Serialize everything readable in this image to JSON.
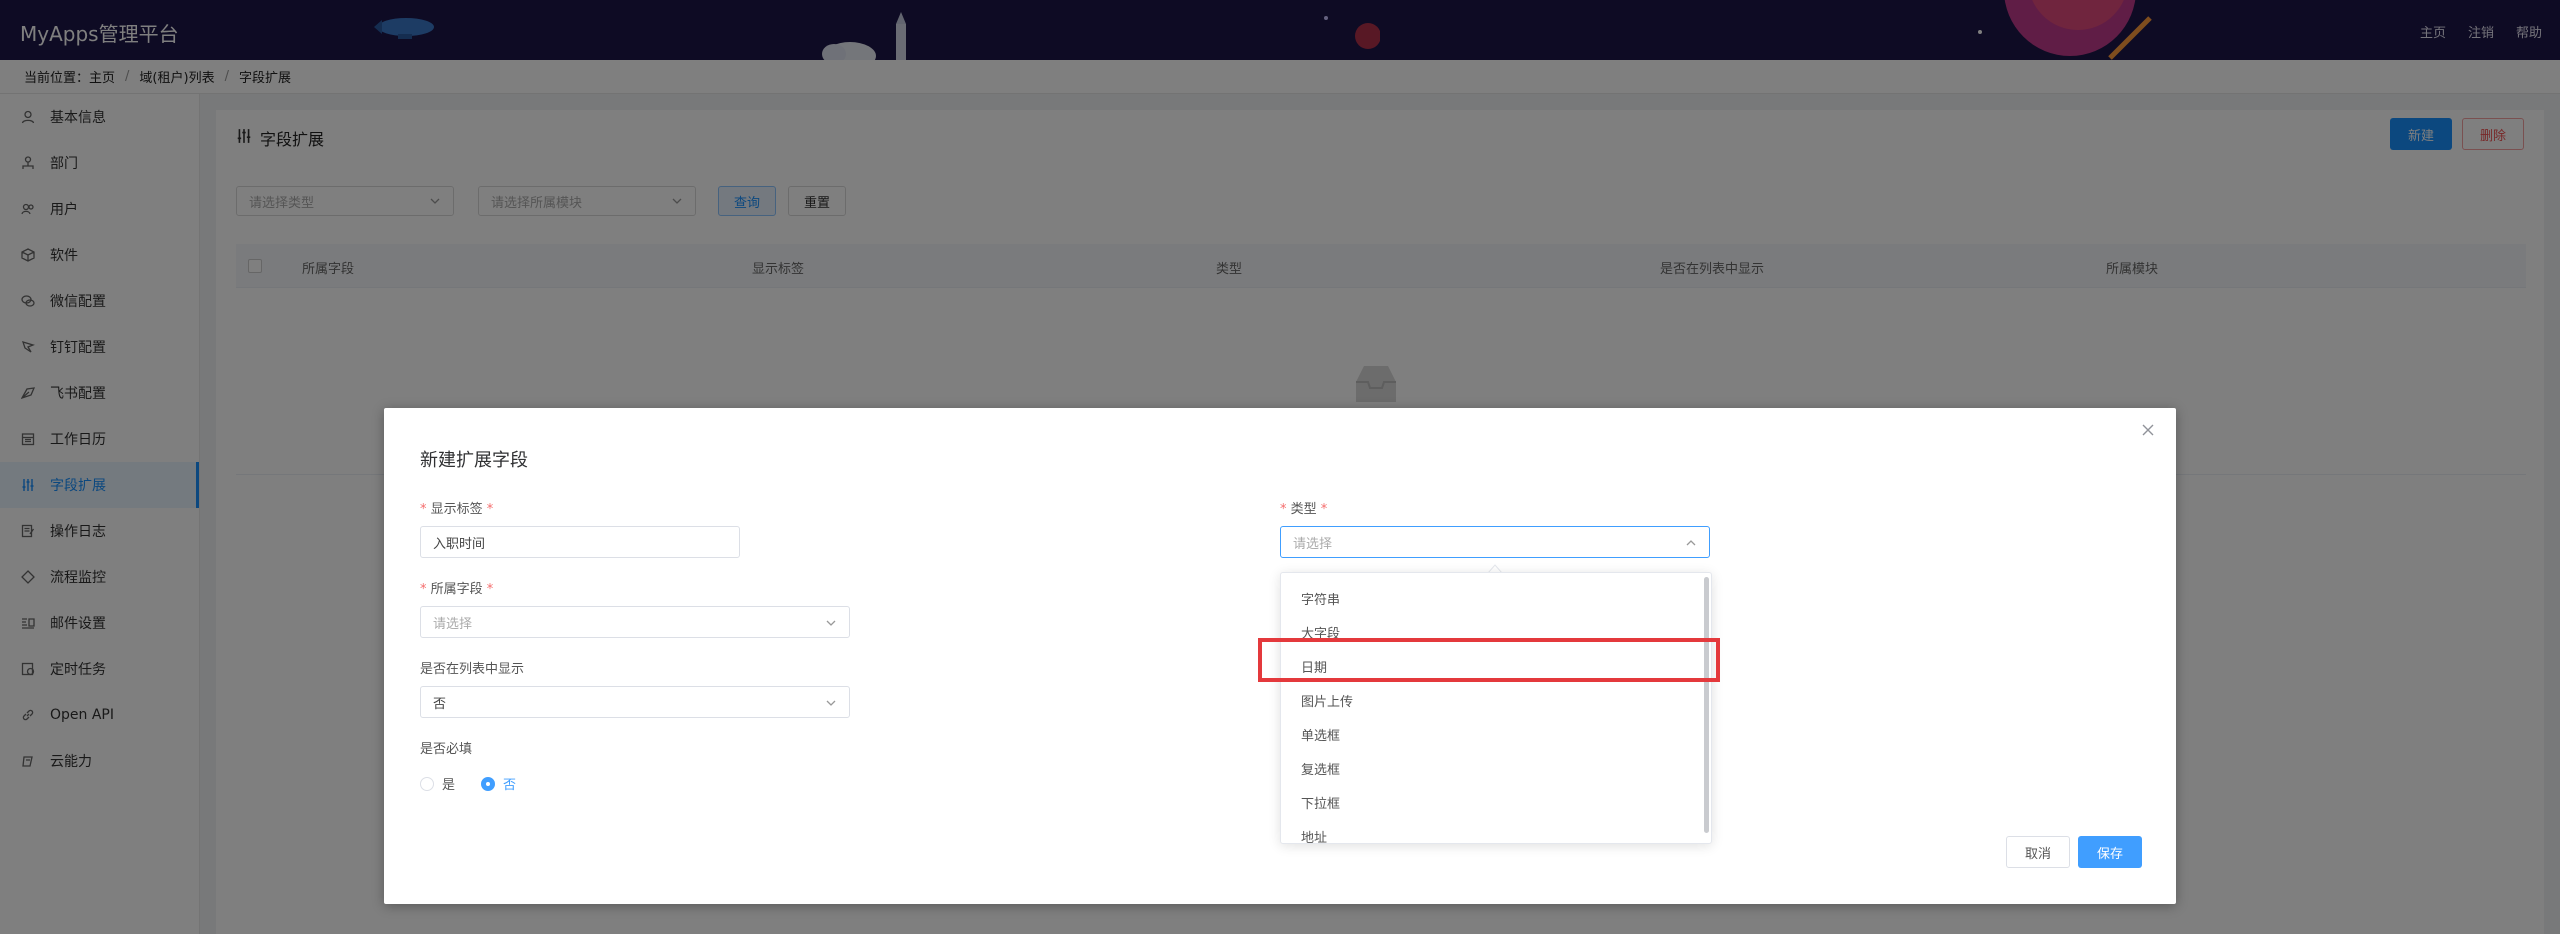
{
  "header": {
    "app_title": "MyApps管理平台",
    "nav": [
      "主页",
      "注销",
      "帮助"
    ]
  },
  "breadcrumb": {
    "prefix": "当前位置：",
    "items": [
      "主页",
      "域(租户)列表",
      "字段扩展"
    ]
  },
  "sidebar": {
    "items": [
      {
        "label": "基本信息",
        "icon": "user-icon"
      },
      {
        "label": "部门",
        "icon": "org-icon"
      },
      {
        "label": "用户",
        "icon": "users-icon"
      },
      {
        "label": "软件",
        "icon": "box-icon"
      },
      {
        "label": "微信配置",
        "icon": "wechat-icon"
      },
      {
        "label": "钉钉配置",
        "icon": "dingtalk-icon"
      },
      {
        "label": "飞书配置",
        "icon": "feishu-icon"
      },
      {
        "label": "工作日历",
        "icon": "calendar-icon"
      },
      {
        "label": "字段扩展",
        "icon": "sliders-icon",
        "active": true
      },
      {
        "label": "操作日志",
        "icon": "log-icon"
      },
      {
        "label": "流程监控",
        "icon": "monitor-icon"
      },
      {
        "label": "邮件设置",
        "icon": "mail-icon"
      },
      {
        "label": "定时任务",
        "icon": "timer-icon"
      },
      {
        "label": "Open API",
        "icon": "link-icon"
      },
      {
        "label": "云能力",
        "icon": "cloud-icon"
      }
    ]
  },
  "main": {
    "title": "字段扩展",
    "new_label": "新建",
    "delete_label": "删除",
    "filter_type_placeholder": "请选择类型",
    "filter_module_placeholder": "请选择所属模块",
    "query_label": "查询",
    "reset_label": "重置",
    "columns": [
      "所属字段",
      "显示标签",
      "类型",
      "是否在列表中显示",
      "所属模块"
    ]
  },
  "dialog": {
    "title": "新建扩展字段",
    "display_label": {
      "label": "显示标签",
      "value": "入职时间"
    },
    "type": {
      "label": "类型",
      "placeholder": "请选择"
    },
    "field": {
      "label": "所属字段",
      "placeholder": "请选择"
    },
    "show_in_list": {
      "label": "是否在列表中显示",
      "value": "否"
    },
    "required": {
      "label": "是否必填",
      "options": [
        "是",
        "否"
      ],
      "selected": "否"
    },
    "cancel_label": "取消",
    "save_label": "保存"
  },
  "dropdown": {
    "options": [
      "字符串",
      "大字段",
      "日期",
      "图片上传",
      "单选框",
      "复选框",
      "下拉框",
      "地址"
    ],
    "highlighted": "日期"
  },
  "colors": {
    "primary": "#409eff",
    "header_bg": "#1c1648",
    "highlight_border": "#e4393c",
    "danger": "#f56c6c"
  }
}
